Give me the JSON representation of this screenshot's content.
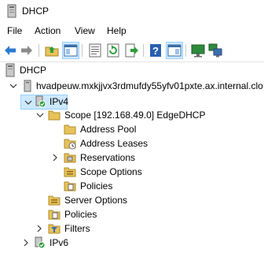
{
  "window": {
    "title": "DHCP"
  },
  "menu": [
    "File",
    "Action",
    "View",
    "Help"
  ],
  "toolbar": {
    "buttons": [
      "back-arrow-icon",
      "forward-arrow-icon",
      "up-folder-icon",
      "show-hide-tree-icon",
      "properties-icon",
      "refresh-icon",
      "export-list-icon",
      "help-icon",
      "show-hide-action-pane-icon",
      "display-statistics-icon",
      "servers-icon"
    ]
  },
  "tree": {
    "root": "DHCP",
    "server": "hvadpeuw.mxkjjvx3rdmufdy55yfv01pxte.ax.internal.clo",
    "ipv4": "IPv4",
    "scope": "Scope [192.168.49.0] EdgeDHCP",
    "scope_children": [
      "Address Pool",
      "Address Leases",
      "Reservations",
      "Scope Options",
      "Policies"
    ],
    "server_options": "Server Options",
    "policies": "Policies",
    "filters": "Filters",
    "ipv6": "IPv6"
  }
}
